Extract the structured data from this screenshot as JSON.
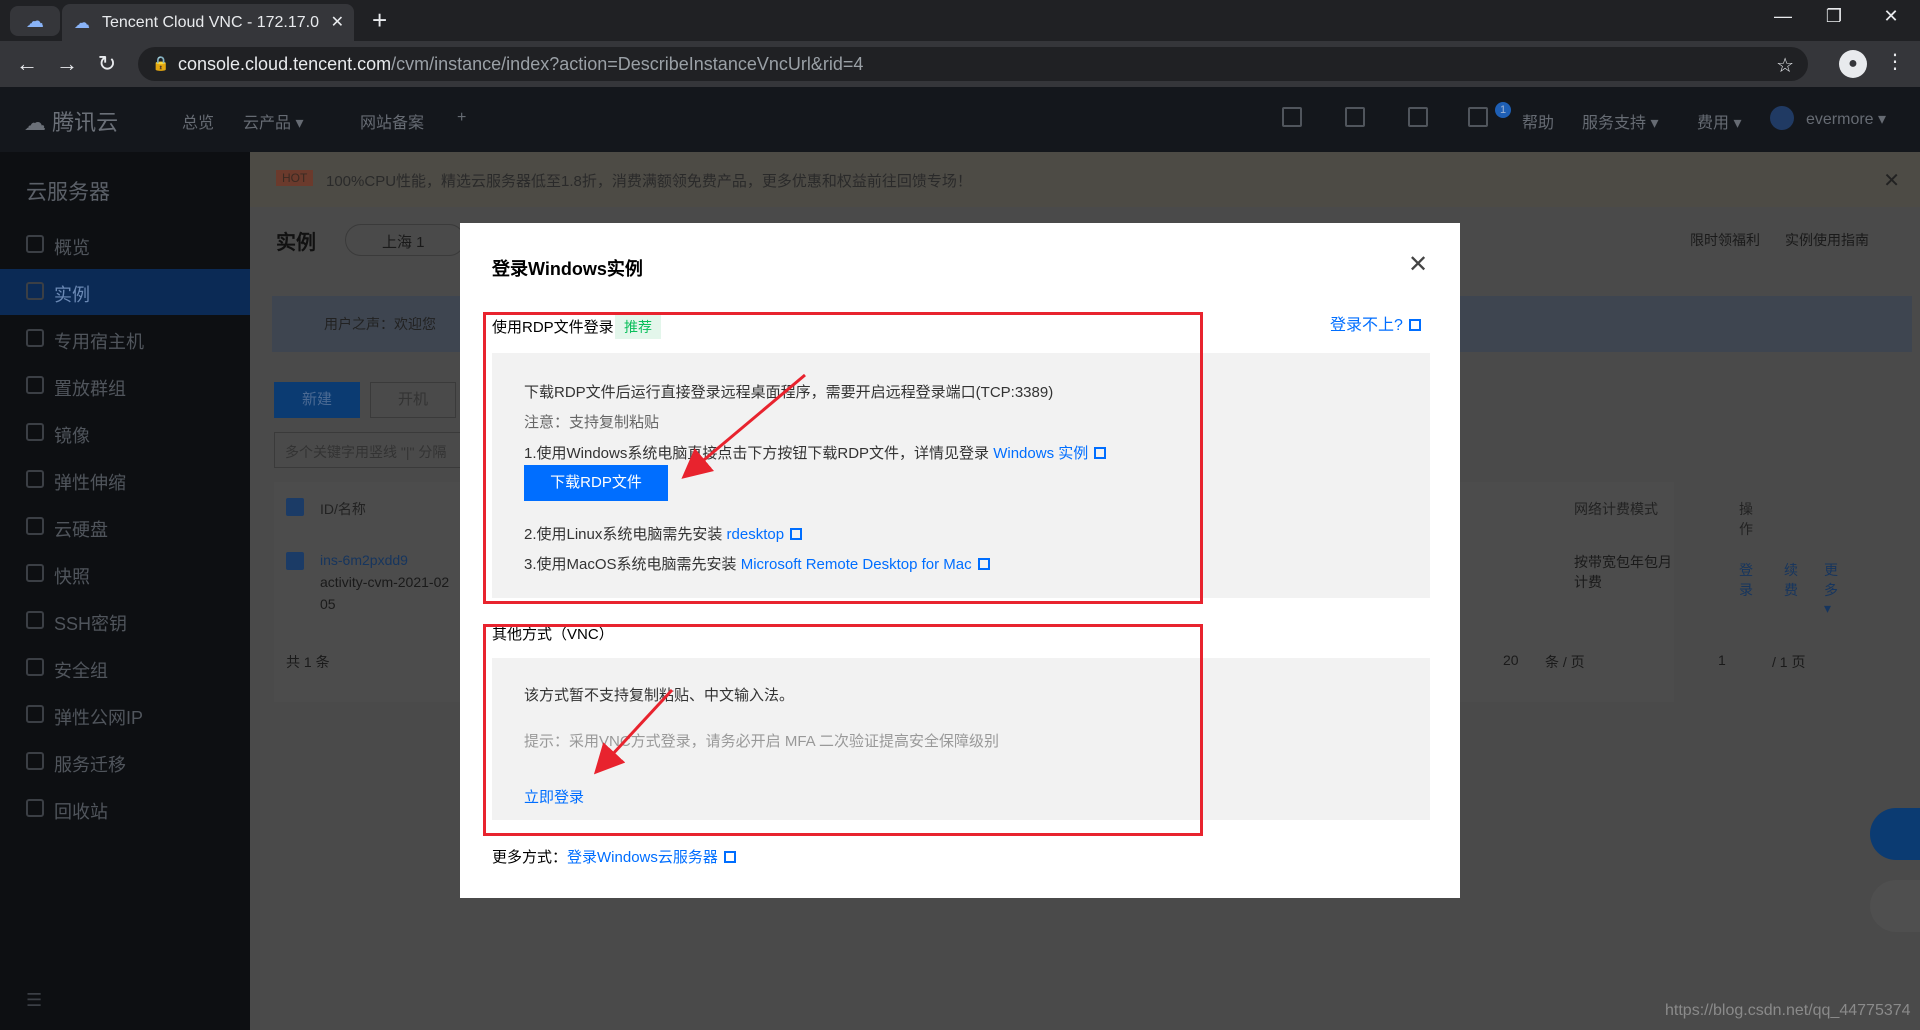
{
  "browser": {
    "tab_title": "Tencent Cloud VNC - 172.17.0",
    "url_host": "console.cloud.tencent.com",
    "url_path": "/cvm/instance/index?action=DescribeInstanceVncUrl&rid=4",
    "icons": [
      "cloud-icon",
      "close-icon",
      "plus-icon",
      "back-icon",
      "forward-icon",
      "reload-icon",
      "lock-icon",
      "star-icon",
      "profile-icon",
      "menu-icon"
    ]
  },
  "topnav": {
    "logo": "腾讯云",
    "items": [
      "总览",
      "云产品 ▾",
      "网站备案",
      "+"
    ],
    "badge": "1",
    "right_items": [
      "帮助",
      "服务支持 ▾",
      "费用 ▾"
    ],
    "user": "evermore ▾"
  },
  "sidebar": {
    "title": "云服务器",
    "items": [
      "概览",
      "实例",
      "专用宿主机",
      "置放群组",
      "镜像",
      "弹性伸缩",
      "云硬盘",
      "快照",
      "SSH密钥",
      "安全组",
      "弹性公网IP",
      "服务迁移",
      "回收站"
    ],
    "active_index": 1
  },
  "main": {
    "hot_tag": "HOT",
    "hot_text": "100%CPU性能，精选云服务器低至1.8折，消费满额领免费产品，更多优惠和权益前往回馈专场！",
    "page_title": "实例",
    "region": "上海 1",
    "right_links": [
      "限时领福利",
      "实例使用指南"
    ],
    "notice": "用户之声：欢迎您",
    "btn_new": "新建",
    "btn_start": "开机",
    "search_placeholder": "多个关键字用竖线 \"|\" 分隔",
    "col_id": "ID/名称",
    "col_billing": "网络计费模式",
    "col_ops": "操作",
    "row_id": "ins-6m2pxdd9",
    "row_name_1": "activity-cvm-2021-02",
    "row_name_2": "05",
    "row_billing": "按带宽包年包月计费",
    "row_ops": [
      "登录",
      "续费",
      "更多 ▾"
    ],
    "total": "共 1 条",
    "page_size": "20",
    "page_size_unit": "条 / 页",
    "page_num": "1",
    "page_total": "/ 1 页"
  },
  "modal": {
    "title": "登录Windows实例",
    "cant_login": "登录不上?",
    "rdp_section_title": "使用RDP文件登录",
    "recommend_tag": "推荐",
    "rdp_line1": "下载RDP文件后运行直接登录远程桌面程序，需要开启远程登录端口(TCP:3389)",
    "rdp_note": "注意：支持复制粘贴",
    "rdp_step1_text": "1.使用Windows系统电脑直接点击下方按钮下载RDP文件，详情见登录",
    "rdp_step1_link": "Windows 实例",
    "download_btn": "下载RDP文件",
    "rdp_step2_text": "2.使用Linux系统电脑需先安装",
    "rdp_step2_link": "rdesktop",
    "rdp_step3_text": "3.使用MacOS系统电脑需先安装",
    "rdp_step3_link": "Microsoft Remote Desktop for Mac",
    "vnc_section_title": "其他方式（VNC）",
    "vnc_line1": "该方式暂不支持复制粘贴、中文输入法。",
    "vnc_tip": "提示：采用VNC方式登录，请务必开启 MFA 二次验证提高安全保障级别",
    "vnc_login_link": "立即登录",
    "more_ways_label": "更多方式：",
    "more_ways_link": "登录Windows云服务器"
  },
  "watermark": "https://blog.csdn.net/qq_44775374",
  "colors": {
    "accent": "#006eff",
    "annotation_red": "#e8232e",
    "recommend_green": "#0abf5b"
  }
}
